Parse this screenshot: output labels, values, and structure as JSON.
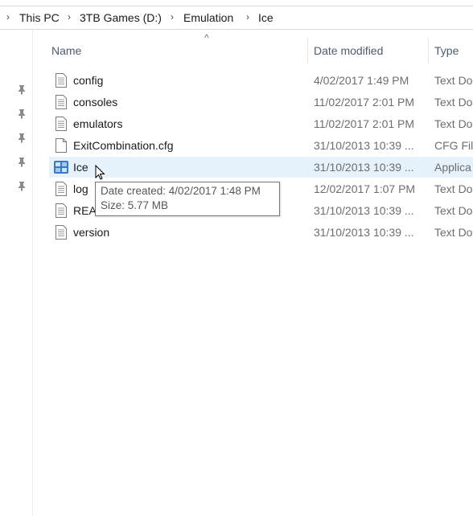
{
  "breadcrumb": {
    "items": [
      {
        "label": "This PC"
      },
      {
        "label": "3TB Games (D:)"
      },
      {
        "label": "Emulation"
      },
      {
        "label": "Ice"
      }
    ]
  },
  "columns": {
    "name": "Name",
    "date_modified": "Date modified",
    "type": "Type"
  },
  "files": [
    {
      "name": "config",
      "date": "4/02/2017 1:49 PM",
      "type": "Text Doc",
      "icon": "text-document-icon"
    },
    {
      "name": "consoles",
      "date": "11/02/2017 2:01 PM",
      "type": "Text Doc",
      "icon": "text-document-icon"
    },
    {
      "name": "emulators",
      "date": "11/02/2017 2:01 PM",
      "type": "Text Doc",
      "icon": "text-document-icon"
    },
    {
      "name": "ExitCombination.cfg",
      "date": "31/10/2013 10:39 ...",
      "type": "CFG File",
      "icon": "cfg-file-icon"
    },
    {
      "name": "Ice",
      "date": "31/10/2013 10:39 ...",
      "type": "Applica",
      "icon": "application-icon",
      "selected": true
    },
    {
      "name": "log",
      "date": "12/02/2017 1:07 PM",
      "type": "Text Doc",
      "icon": "text-document-icon"
    },
    {
      "name": "REA",
      "date": "31/10/2013 10:39 ...",
      "type": "Text Doc",
      "icon": "text-document-icon"
    },
    {
      "name": "version",
      "date": "31/10/2013 10:39 ...",
      "type": "Text Doc",
      "icon": "text-document-icon"
    }
  ],
  "tooltip": {
    "line1": "Date created: 4/02/2017 1:48 PM",
    "line2": "Size: 5.77 MB"
  },
  "colors": {
    "selection": "#e5f1fb",
    "header_text": "#4b5c70",
    "secondary_text": "#6d6d6d",
    "pin": "#8a8a8a"
  }
}
